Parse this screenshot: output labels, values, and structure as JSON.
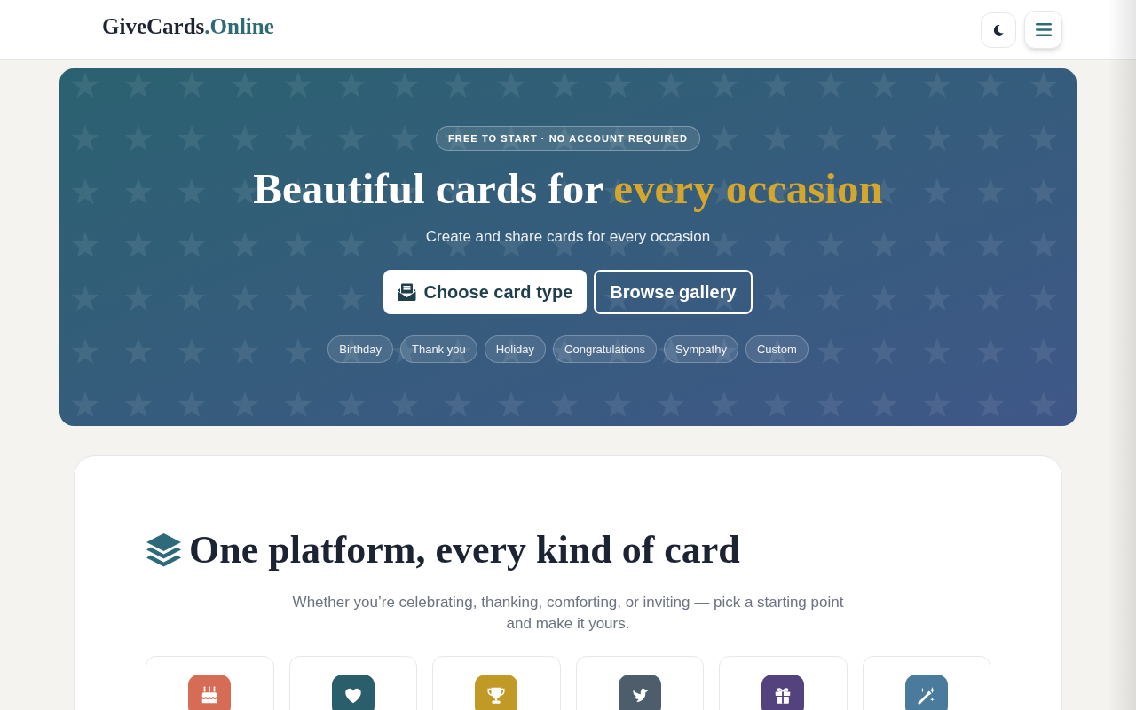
{
  "header": {
    "logo": {
      "name": "GiveCards",
      "suffix": ".Online"
    }
  },
  "hero": {
    "badge": "FREE TO START · NO ACCOUNT REQUIRED",
    "headline": {
      "text": "Beautiful cards for",
      "highlight": "every occasion"
    },
    "subtitle": "Create and share cards for every occasion",
    "buttons": [
      {
        "label": "Choose card type",
        "kind": "primary"
      },
      {
        "label": "Browse gallery",
        "kind": "outline"
      }
    ],
    "chips": [
      "Birthday",
      "Thank you",
      "Holiday",
      "Congratulations",
      "Sympathy",
      "Custom"
    ]
  },
  "section": {
    "title": "One platform, every kind of card",
    "description": "Whether you’re celebrating, thanking, comforting, or inviting — pick a starting point and make it yours.",
    "card_types": [
      {
        "color": "#d66c55"
      },
      {
        "color": "#2b5e6b"
      },
      {
        "color": "#c09a24"
      },
      {
        "color": "#4e5d6c"
      },
      {
        "color": "#54427f"
      },
      {
        "color": "#4a7a9c"
      }
    ]
  }
}
